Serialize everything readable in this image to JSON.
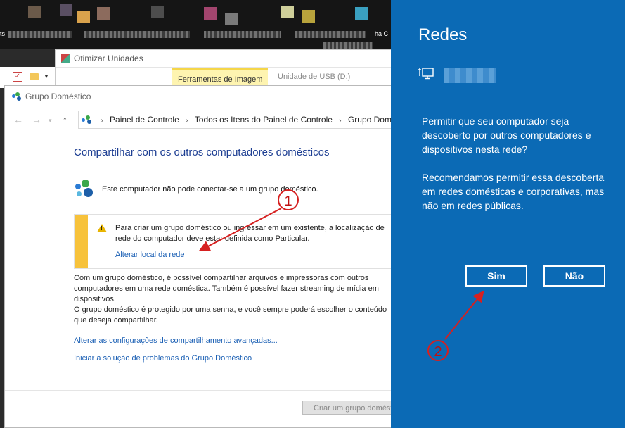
{
  "desktop": {
    "edge_left": "ts",
    "edge_right": "ha C"
  },
  "back_window": {
    "title": "Otimizar Unidades",
    "ribbon_tab_active": "Ferramentas de Imagem",
    "ribbon_tab_drive": "Unidade de USB (D:)"
  },
  "main_window": {
    "title": "Grupo Doméstico",
    "breadcrumb": [
      "Painel de Controle",
      "Todos os Itens do Painel de Controle",
      "Grupo Doméstico"
    ],
    "heading": "Compartilhar com os outros computadores domésticos",
    "status": "Este computador não pode conectar-se a um grupo doméstico.",
    "warning_text": "Para criar um grupo doméstico ou ingressar em um existente, a localização de rede do computador deve estar definida como Particular.",
    "warning_link": "Alterar local da rede",
    "para1": "Com um grupo doméstico, é possível compartilhar arquivos e impressoras com outros computadores em uma rede doméstica. Também é possível fazer streaming de mídia em dispositivos.",
    "para2": "O grupo doméstico é protegido por uma senha, e você sempre poderá escolher o conteúdo que deseja compartilhar.",
    "link_advanced": "Alterar as configurações de compartilhamento avançadas...",
    "link_troubleshoot": "Iniciar a solução de problemas do Grupo Doméstico",
    "create_button": "Criar um grupo doméstico"
  },
  "flyout": {
    "title": "Redes",
    "question": "Permitir que seu computador seja descoberto por outros computadores e dispositivos nesta rede?",
    "recommendation": "Recomendamos permitir essa descoberta em redes domésticas e corporativas, mas não em redes públicas.",
    "yes_label": "Sim",
    "no_label": "Não"
  },
  "annotations": {
    "marker1": "1",
    "marker2": "2"
  },
  "colors": {
    "flyout_bg": "#0b6ab5",
    "annotation_red": "#d62020",
    "link_blue": "#1a5fb4",
    "heading_blue": "#1e3f93"
  }
}
